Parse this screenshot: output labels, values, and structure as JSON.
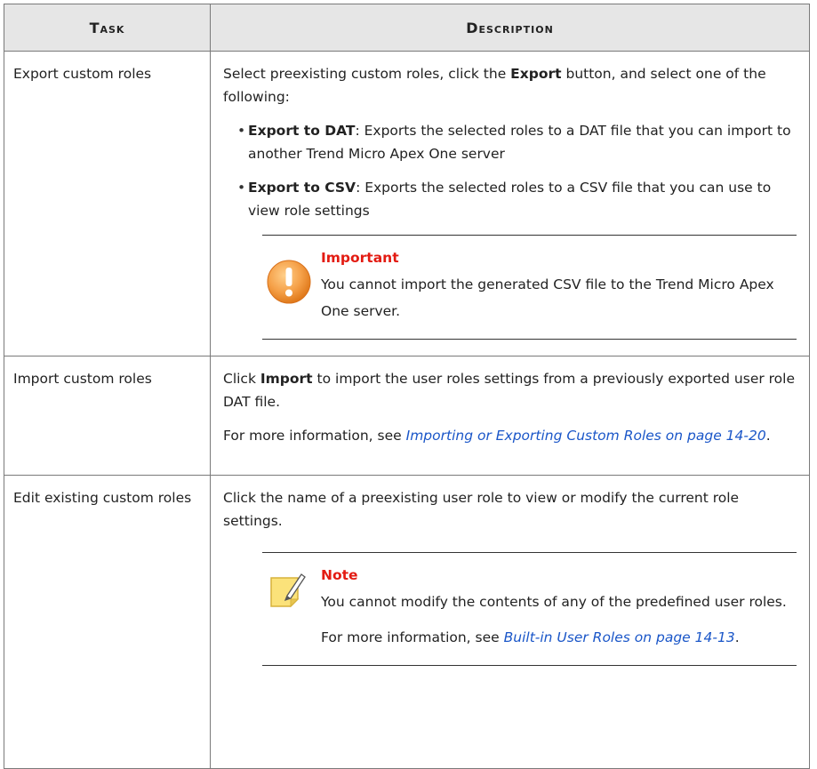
{
  "table": {
    "headers": {
      "task": "Task",
      "description": "Description"
    },
    "rows": [
      {
        "task": "Export custom roles",
        "intro_pre": "Select preexisting custom roles, click the ",
        "intro_bold": "Export",
        "intro_post": " button, and select one of the following:",
        "bullets": [
          {
            "bold": "Export to DAT",
            "text": ": Exports the selected roles to a DAT file that you can import to another Trend Micro Apex One server"
          },
          {
            "bold": "Export to CSV",
            "text": ": Exports the selected roles to a CSV file that you can use to view role settings"
          }
        ],
        "admonition": {
          "icon": "important-icon",
          "title": "Important",
          "text": "You cannot import the generated CSV file to the Trend Micro Apex One server."
        }
      },
      {
        "task": "Import custom roles",
        "p1_pre": "Click ",
        "p1_bold": "Import",
        "p1_post": " to import the user roles settings from a previously exported user role DAT file.",
        "p2_pre": "For more information, see ",
        "p2_link": "Importing or Exporting Custom Roles on page 14-20",
        "p2_post": "."
      },
      {
        "task": "Edit existing custom roles",
        "p1": "Click the name of a preexisting user role to view or modify the current role settings.",
        "admonition": {
          "icon": "note-icon",
          "title": "Note",
          "text": "You cannot modify the contents of any of the predefined user roles.",
          "more_pre": "For more information, see ",
          "more_link": "Built-in User Roles on page 14-13",
          "more_post": "."
        }
      }
    ]
  },
  "colors": {
    "header_bg": "#e6e6e6",
    "admonition_title": "#e31b12",
    "link": "#1a56c8"
  }
}
